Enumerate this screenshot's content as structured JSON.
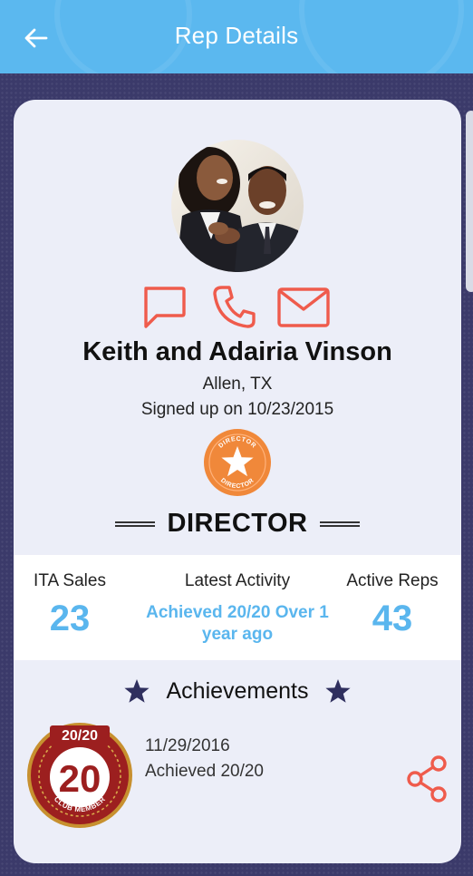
{
  "appbar": {
    "title": "Rep Details"
  },
  "profile": {
    "name": "Keith and Adairia Vinson",
    "location": "Allen, TX",
    "signed_up": "Signed up on 10/23/2015"
  },
  "rank": {
    "badge_text": "DIRECTOR",
    "label": "DIRECTOR"
  },
  "stats": {
    "ita_sales_label": "ITA Sales",
    "ita_sales_value": "23",
    "latest_activity_label": "Latest Activity",
    "latest_activity_value": "Achieved 20/20 Over 1 year ago",
    "active_reps_label": "Active Reps",
    "active_reps_value": "43"
  },
  "achievements": {
    "title": "Achievements",
    "items": [
      {
        "badge_top": "20/20",
        "badge_number": "20",
        "badge_bottom": "CLUB MEMBER",
        "date": "11/29/2016",
        "description": "Achieved 20/20"
      }
    ]
  },
  "colors": {
    "appbar": "#5bb8ef",
    "accent_blue": "#5ab6ee",
    "icon_red": "#ef5b4c",
    "badge_orange": "#f0883a",
    "navy_star": "#2f2f5e",
    "background": "#3b3a6a"
  },
  "icons": {
    "back": "arrow-left-icon",
    "message": "message-icon",
    "phone": "phone-icon",
    "email": "email-icon",
    "share": "share-icon",
    "star": "star-icon"
  }
}
